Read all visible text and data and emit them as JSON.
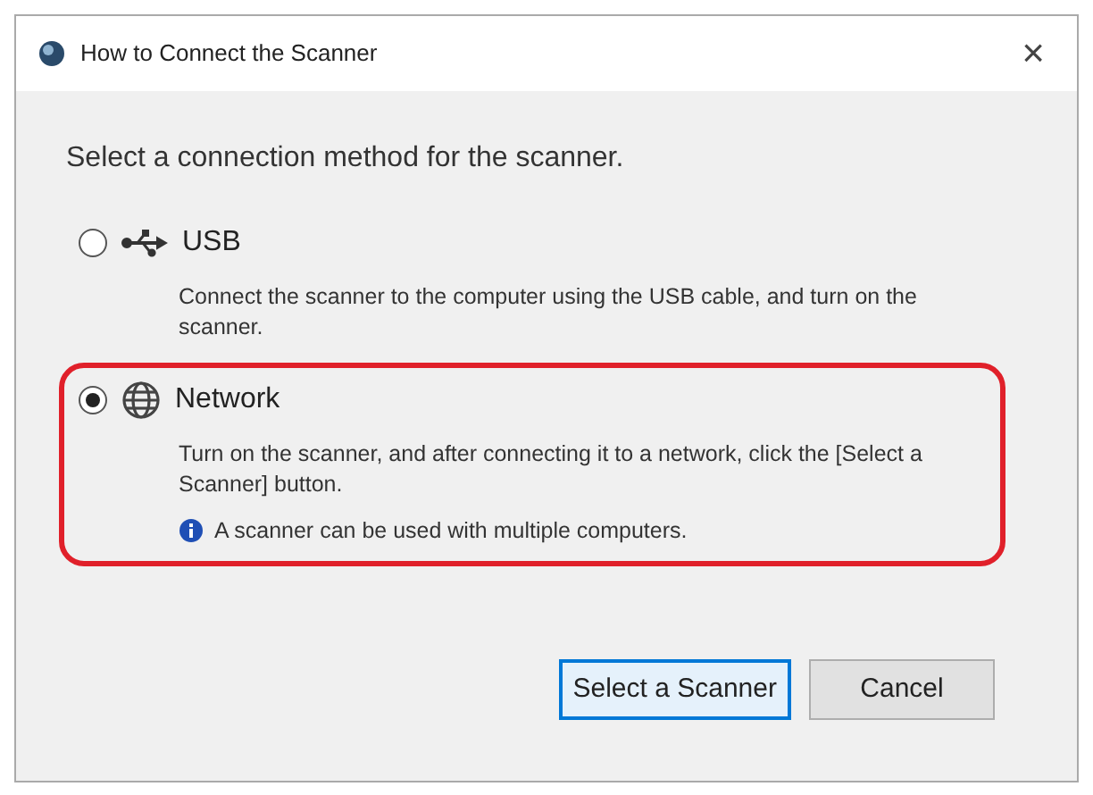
{
  "window": {
    "title": "How to Connect the Scanner",
    "close": "×"
  },
  "heading": "Select a connection method for the scanner.",
  "options": [
    {
      "kind": "usb",
      "label": "USB",
      "selected": false,
      "highlighted": false,
      "description": "Connect the scanner to the computer using the USB cable, and turn on the scanner."
    },
    {
      "kind": "network",
      "label": "Network",
      "selected": true,
      "highlighted": true,
      "description": "Turn on the scanner, and after connecting it to a network, click the [Select a Scanner] button.",
      "note": "A scanner can be used with multiple computers."
    }
  ],
  "buttons": [
    {
      "label": "Select a Scanner",
      "default": true
    },
    {
      "label": "Cancel",
      "default": false
    }
  ]
}
